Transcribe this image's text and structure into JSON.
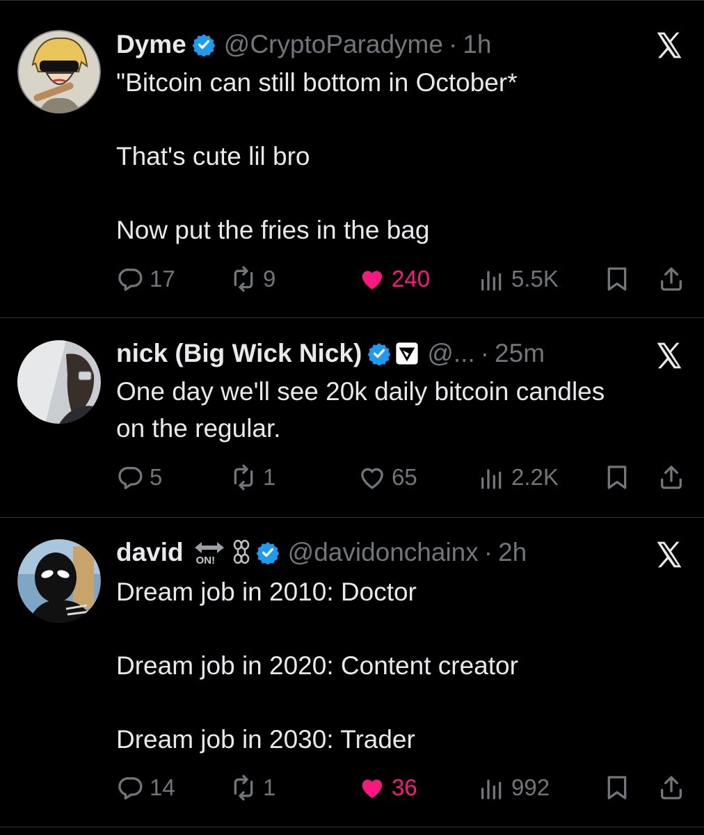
{
  "colors": {
    "background": "#000000",
    "text": "#e7e9ea",
    "muted": "#71767b",
    "like": "#f91880",
    "verified": "#1d9bf0",
    "divider": "#2f3336"
  },
  "tweets": [
    {
      "name": "Dyme",
      "handle": "@CryptoParadyme",
      "separator": "·",
      "time": "1h",
      "lines": [
        "\"Bitcoin can still bottom in October*",
        "",
        "That's cute lil bro",
        "",
        "Now put the fries in the bag"
      ],
      "replies": "17",
      "reposts": "9",
      "likes": "240",
      "liked": true,
      "views": "5.5K"
    },
    {
      "name": "nick (Big Wick Nick)",
      "handle": "@...",
      "separator": "·",
      "time": "25m",
      "lines": [
        "One day we'll see 20k daily bitcoin candles",
        "on the regular."
      ],
      "replies": "5",
      "reposts": "1",
      "likes": "65",
      "liked": false,
      "views": "2.2K"
    },
    {
      "name": "david",
      "badge_text": "ON!",
      "handle": "@davidonchainx",
      "separator": "·",
      "time": "2h",
      "lines": [
        "Dream job in 2010: Doctor",
        "",
        "Dream job in 2020: Content creator",
        "",
        "Dream job in 2030: Trader"
      ],
      "replies": "14",
      "reposts": "1",
      "likes": "36",
      "liked": true,
      "views": "992"
    }
  ],
  "icons": [
    "reply-icon",
    "repost-icon",
    "like-icon",
    "views-icon",
    "bookmark-icon",
    "share-icon",
    "x-logo-icon",
    "verified-badge-icon"
  ]
}
